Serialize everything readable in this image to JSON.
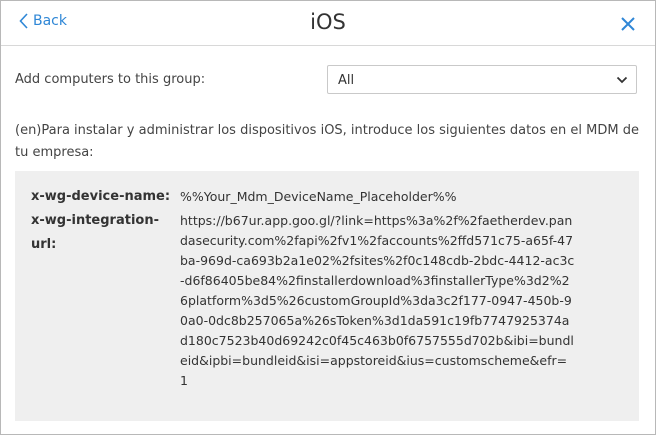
{
  "header": {
    "back_label": "Back",
    "title": "iOS",
    "back_icon": "chevron-left-icon",
    "close_icon": "close-icon"
  },
  "group": {
    "label": "Add computers to this group:",
    "selected": "All",
    "chevron_icon": "chevron-down-icon"
  },
  "intro_text": "(en)Para instalar y administrar los dispositivos iOS, introduce los siguientes datos en el MDM de tu empresa:",
  "params": [
    {
      "key": "x-wg-device-name:",
      "value": "%%Your_Mdm_DeviceName_Placeholder%%"
    },
    {
      "key": "x-wg-integration-url:",
      "value": "https://b67ur.app.goo.gl/?link=https%3a%2f%2faetherdev.pandasecurity.com%2fapi%2fv1%2faccounts%2ffd571c75-a65f-47ba-969d-ca693b2a1e02%2fsites%2f0c148cdb-2bdc-4412-ac3c-d6f86405be84%2finstallerdownload%3finstallerType%3d2%26platform%3d5%26customGroupId%3da3c2f177-0947-450b-90a0-0dc8b257065a%26sToken%3d1da591c19fb7747925374ad180c7523b40d69242c0f45c463b0f6757555d702b&ibi=bundleid&ipbi=bundleid&isi=appstoreid&ius=customscheme&efr=1"
    }
  ],
  "colors": {
    "accent": "#2f87d6",
    "panel_bg": "#efefef",
    "border": "#c9c9c9"
  }
}
